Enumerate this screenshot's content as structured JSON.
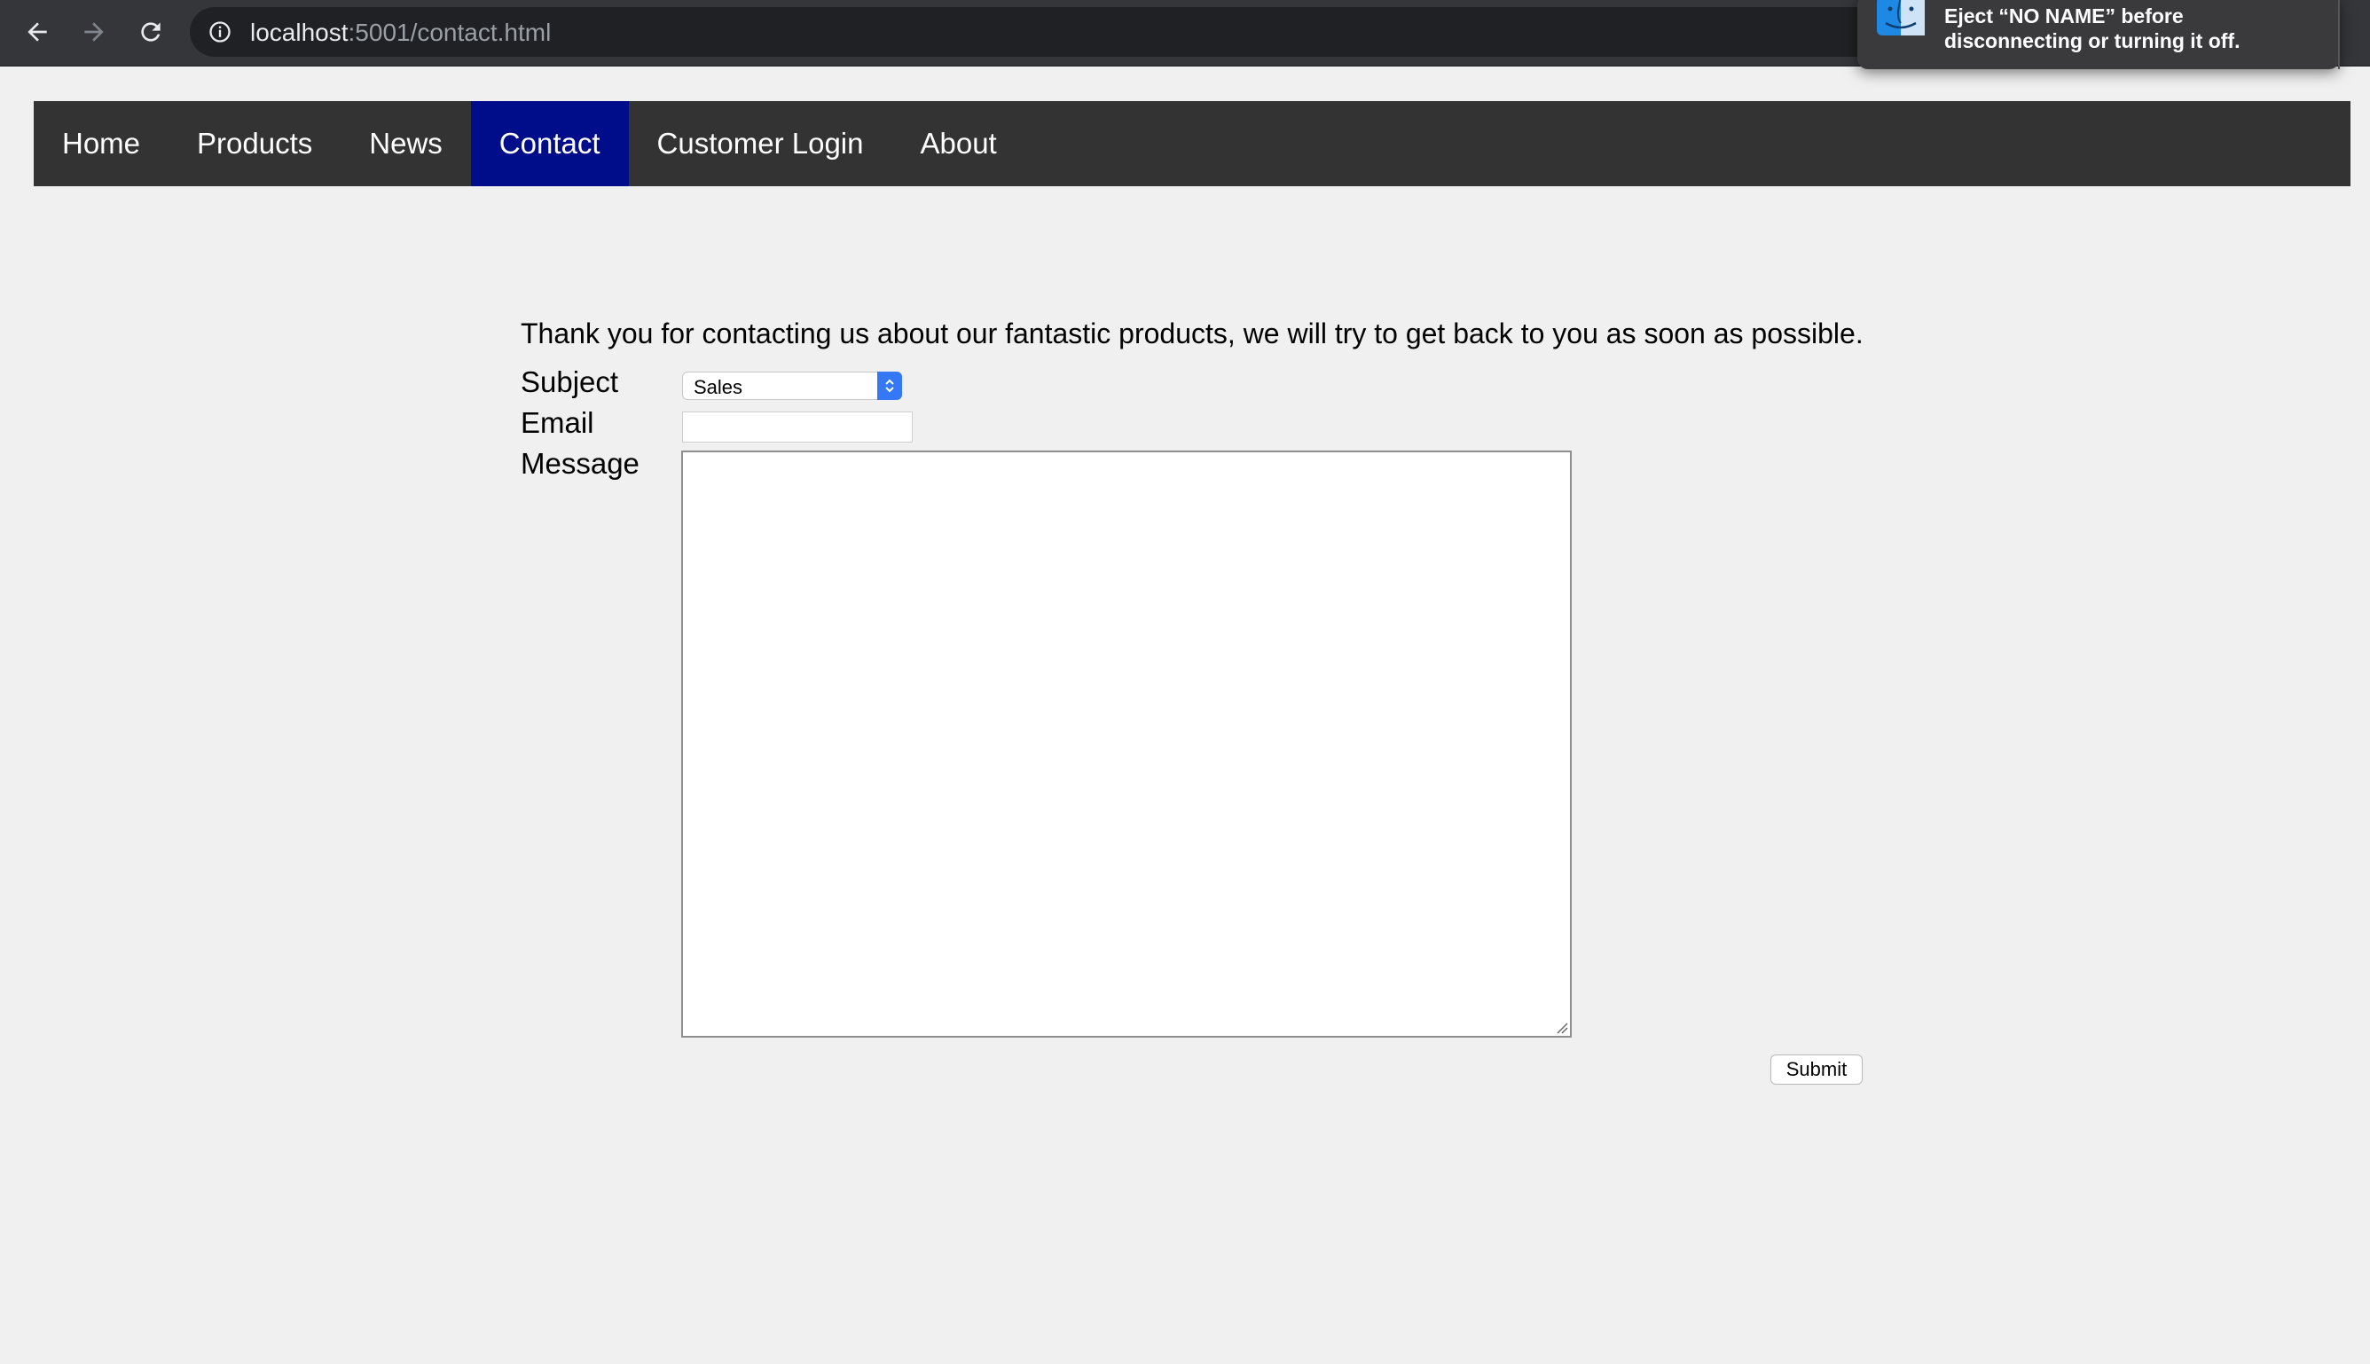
{
  "browser": {
    "url_host": "localhost",
    "url_rest": ":5001/contact.html",
    "icons": {
      "back": "back-arrow-icon",
      "forward": "forward-arrow-icon",
      "reload": "reload-icon",
      "site_info": "info-icon"
    }
  },
  "notification": {
    "text": "Eject “NO NAME” before disconnecting or turning it off.",
    "icon": "finder-icon"
  },
  "nav": {
    "items": [
      {
        "label": "Home"
      },
      {
        "label": "Products"
      },
      {
        "label": "News"
      },
      {
        "label": "Contact",
        "active": true
      },
      {
        "label": "Customer Login"
      },
      {
        "label": "About"
      }
    ],
    "active_color": "#000d8a",
    "bar_color": "#333333"
  },
  "contact": {
    "intro": "Thank you for contacting us about our fantastic products, we will try to get back to you as soon as possible.",
    "subject_label": "Subject",
    "subject_value": "Sales",
    "email_label": "Email",
    "email_value": "",
    "message_label": "Message",
    "message_value": "",
    "submit_label": "Submit"
  }
}
